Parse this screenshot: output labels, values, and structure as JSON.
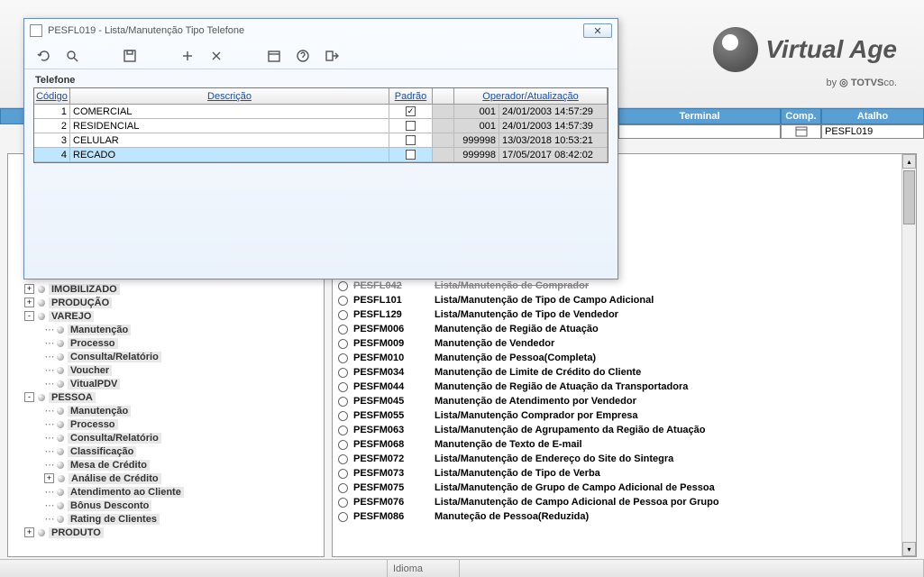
{
  "brand": {
    "name": "Virtual Age",
    "byline": "by",
    "company": "TOTVS",
    "suffix": "co."
  },
  "columns": {
    "terminal": "Terminal",
    "comp": "Comp.",
    "atalho": "Atalho",
    "atalho_value": "PESFL019"
  },
  "tree": [
    {
      "type": "node",
      "level": 1,
      "toggle": "+",
      "label": "IMOBILIZADO"
    },
    {
      "type": "node",
      "level": 1,
      "toggle": "+",
      "label": "PRODUÇÃO"
    },
    {
      "type": "node",
      "level": 1,
      "toggle": "-",
      "label": "VAREJO"
    },
    {
      "type": "leaf",
      "level": 2,
      "label": "Manutenção"
    },
    {
      "type": "leaf",
      "level": 2,
      "label": "Processo"
    },
    {
      "type": "leaf",
      "level": 2,
      "label": "Consulta/Relatório"
    },
    {
      "type": "leaf",
      "level": 2,
      "label": "Voucher"
    },
    {
      "type": "leaf",
      "level": 2,
      "label": "VitualPDV"
    },
    {
      "type": "node",
      "level": 1,
      "toggle": "-",
      "label": "PESSOA"
    },
    {
      "type": "leaf",
      "level": 2,
      "label": "Manutenção"
    },
    {
      "type": "leaf",
      "level": 2,
      "label": "Processo"
    },
    {
      "type": "leaf",
      "level": 2,
      "label": "Consulta/Relatório"
    },
    {
      "type": "leaf",
      "level": 2,
      "label": "Classificação"
    },
    {
      "type": "leaf",
      "level": 2,
      "label": "Mesa de Crédito"
    },
    {
      "type": "node",
      "level": 2,
      "toggle": "+",
      "label": "Análise de Crédito"
    },
    {
      "type": "leaf",
      "level": 2,
      "label": "Atendimento ao Cliente"
    },
    {
      "type": "leaf",
      "level": 2,
      "label": "Bônus Desconto"
    },
    {
      "type": "leaf",
      "level": 2,
      "label": "Rating de Clientes"
    },
    {
      "type": "node",
      "level": 1,
      "toggle": "+",
      "label": "PRODUTO"
    }
  ],
  "list": [
    {
      "code": "PESFL042",
      "desc": "Lista/Manutenção de Comprador",
      "cut": true
    },
    {
      "code": "PESFL101",
      "desc": "Lista/Manutenção de Tipo de Campo Adicional"
    },
    {
      "code": "PESFL129",
      "desc": "Lista/Manutenção de Tipo de Vendedor"
    },
    {
      "code": "PESFM006",
      "desc": "Manutenção de Região de Atuação"
    },
    {
      "code": "PESFM009",
      "desc": "Manutenção de Vendedor"
    },
    {
      "code": "PESFM010",
      "desc": "Manutenção de Pessoa(Completa)"
    },
    {
      "code": "PESFM034",
      "desc": "Manutenção de Limite de Crédito do Cliente"
    },
    {
      "code": "PESFM044",
      "desc": "Manutenção de Região de Atuação da Transportadora"
    },
    {
      "code": "PESFM045",
      "desc": "Manutenção de Atendimento por Vendedor"
    },
    {
      "code": "PESFM055",
      "desc": "Lista/Manutenção Comprador por Empresa"
    },
    {
      "code": "PESFM063",
      "desc": "Lista/Manutenção de Agrupamento da Região de Atuação"
    },
    {
      "code": "PESFM068",
      "desc": "Manutenção de Texto de E-mail"
    },
    {
      "code": "PESFM072",
      "desc": "Lista/Manutenção de Endereço do Site do Sintegra"
    },
    {
      "code": "PESFM073",
      "desc": "Lista/Manutenção de Tipo de Verba"
    },
    {
      "code": "PESFM075",
      "desc": "Lista/Manutenção de Grupo de Campo Adicional de Pessoa"
    },
    {
      "code": "PESFM076",
      "desc": "Lista/Manutenção de Campo Adicional de Pessoa por Grupo"
    },
    {
      "code": "PESFM086",
      "desc": "Manuteção de Pessoa(Reduzida)"
    }
  ],
  "status": {
    "idioma_label": "Idioma"
  },
  "modal": {
    "title": "PESFL019 - Lista/Manutenção Tipo Telefone",
    "group_label": "Telefone",
    "headers": {
      "codigo": "Código",
      "descricao": "Descrição",
      "padrao": "Padrão",
      "operador": "Operador/Atualização"
    },
    "rows": [
      {
        "codigo": "1",
        "descricao": "COMERCIAL",
        "padrao": true,
        "operador": "001",
        "data": "24/01/2003 14:57:29",
        "selected": false
      },
      {
        "codigo": "2",
        "descricao": "RESIDENCIAL",
        "padrao": false,
        "operador": "001",
        "data": "24/01/2003 14:57:39",
        "selected": false
      },
      {
        "codigo": "3",
        "descricao": "CELULAR",
        "padrao": false,
        "operador": "999998",
        "data": "13/03/2018 10:53:21",
        "selected": false
      },
      {
        "codigo": "4",
        "descricao": "RECADO",
        "padrao": false,
        "operador": "999998",
        "data": "17/05/2017 08:42:02",
        "selected": true
      }
    ]
  }
}
